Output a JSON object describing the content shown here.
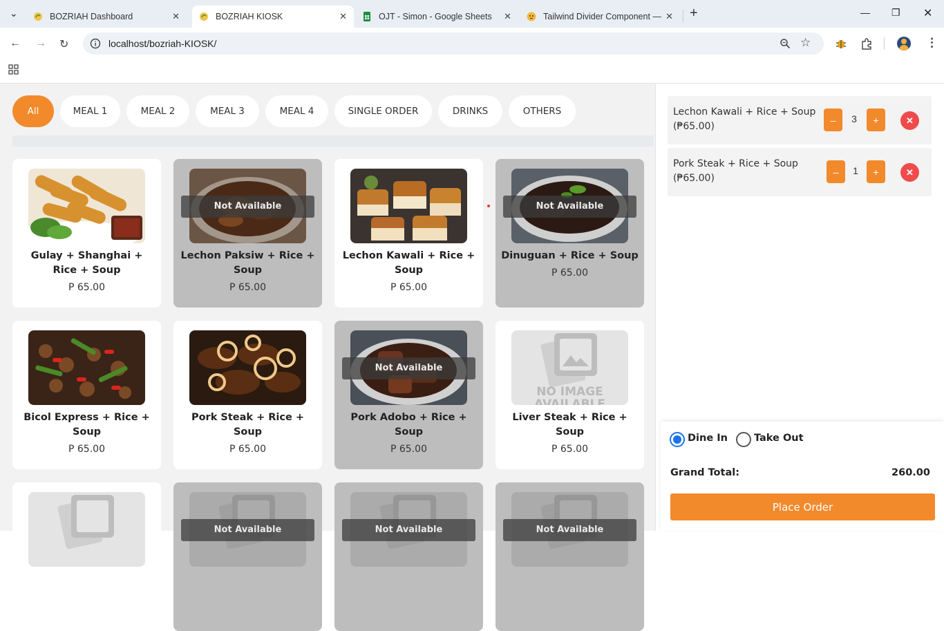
{
  "browser": {
    "tabs": [
      {
        "title": "BOZRIAH Dashboard",
        "active": false
      },
      {
        "title": "BOZRIAH KIOSK",
        "active": true
      },
      {
        "title": "OJT - Simon - Google Sheets",
        "active": false
      },
      {
        "title": "Tailwind Divider Component —",
        "active": false
      }
    ],
    "url": "localhost/bozriah-KIOSK/"
  },
  "categories": [
    {
      "label": "All",
      "active": true
    },
    {
      "label": "MEAL 1"
    },
    {
      "label": "MEAL 2"
    },
    {
      "label": "MEAL 3"
    },
    {
      "label": "MEAL 4"
    },
    {
      "label": "SINGLE ORDER"
    },
    {
      "label": "DRINKS"
    },
    {
      "label": "OTHERS"
    }
  ],
  "menu_items": [
    {
      "name": "Gulay + Shanghai + Rice + Soup",
      "price": "P 65.00",
      "available": true,
      "image": "shanghai-photo"
    },
    {
      "name": "Lechon Paksiw + Rice + Soup",
      "price": "P 65.00",
      "available": false,
      "image": "paksiw-photo"
    },
    {
      "name": "Lechon Kawali + Rice + Soup",
      "price": "P 65.00",
      "available": true,
      "image": "kawali-photo"
    },
    {
      "name": "Dinuguan + Rice + Soup",
      "price": "P 65.00",
      "available": false,
      "image": "dinuguan-photo"
    },
    {
      "name": "Bicol Express + Rice + Soup",
      "price": "P 65.00",
      "available": true,
      "image": "bicol-photo"
    },
    {
      "name": "Pork Steak + Rice + Soup",
      "price": "P 65.00",
      "available": true,
      "image": "porksteak-photo"
    },
    {
      "name": "Pork Adobo + Rice + Soup",
      "price": "P 65.00",
      "available": false,
      "image": "adobo-photo"
    },
    {
      "name": "Liver Steak + Rice + Soup",
      "price": "P 65.00",
      "available": true,
      "image": "no-image"
    }
  ],
  "not_available_label": "Not Available",
  "no_image_label": "NO IMAGE AVAILABLE",
  "cart": {
    "items": [
      {
        "name": "Lechon Kawali + Rice + Soup",
        "price": "(₱65.00)",
        "qty": "3"
      },
      {
        "name": "Pork Steak + Rice + Soup",
        "price": "(₱65.00)",
        "qty": "1"
      }
    ],
    "minus_label": "–",
    "plus_label": "+",
    "remove_label": "✕",
    "order_type": {
      "dine_in": "Dine In",
      "take_out": "Take Out",
      "selected": "dine_in"
    },
    "grand_total_label": "Grand Total:",
    "grand_total": "260.00",
    "place_order_label": "Place Order"
  },
  "colors": {
    "accent": "#f28a2c",
    "remove": "#ef4b4b",
    "unavailable": "#bdbdbd",
    "radio": "#1a73e8"
  }
}
